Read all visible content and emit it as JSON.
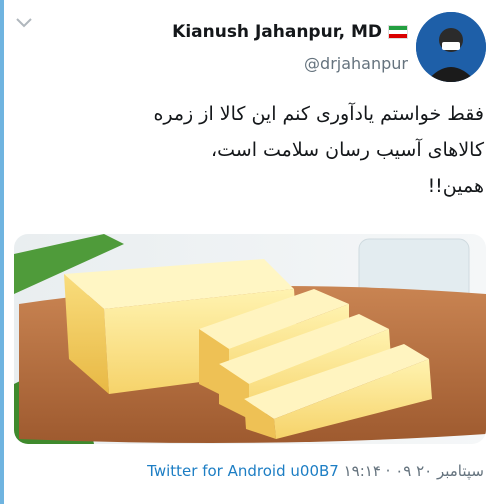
{
  "tweet": {
    "author_name": "Kianush Jahanpur, MD",
    "handle": "@drjahanpur",
    "body_lines": [
      "فقط خواستم یادآوری کنم این کالا از زمره",
      "کالاهای آسیب رسان سلامت است،",
      "همین!!"
    ],
    "timestamp": "۱۹:۱۴ · ۰۹ سپتامبر ۲۰",
    "separator": "u00B7",
    "source": "Twitter for Android"
  },
  "icons": {
    "menu": "chevron-down-icon",
    "flag": "iran-flag-icon"
  },
  "colors": {
    "accent": "#1d7ec4",
    "left_strip": "#6fb4e0",
    "avatar_bg": "#1e5fa8"
  }
}
